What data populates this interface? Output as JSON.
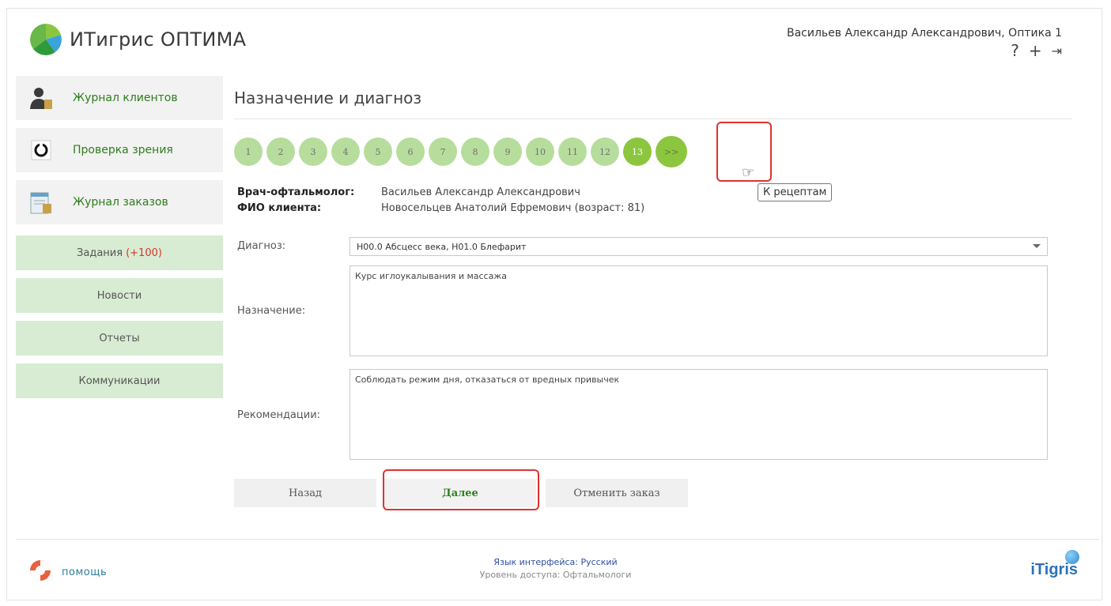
{
  "app": {
    "title": "ИТигрис ОПТИМА",
    "user": "Васильев Александр Александрович, Оптика 1",
    "header_icons": [
      "help-icon",
      "add-icon",
      "logout-icon"
    ]
  },
  "sidebar": {
    "main_items": [
      {
        "label": "Журнал клиентов",
        "icon": "clients-journal-icon"
      },
      {
        "label": "Проверка зрения",
        "icon": "vision-check-icon"
      },
      {
        "label": "Журнал заказов",
        "icon": "orders-journal-icon"
      }
    ],
    "tasks_label": "Задания",
    "tasks_count": "(+100)",
    "links": [
      "Новости",
      "Отчеты",
      "Коммуникации"
    ]
  },
  "page": {
    "title": "Назначение и диагноз",
    "steps": [
      "1",
      "2",
      "3",
      "4",
      "5",
      "6",
      "7",
      "8",
      "9",
      "10",
      "11",
      "12",
      "13"
    ],
    "active_step": "13",
    "next_step_label": ">>",
    "tooltip": "К рецептам"
  },
  "info": {
    "doctor_label": "Врач-офтальмолог:",
    "doctor_value": "Васильев Александр Александрович",
    "client_label": "ФИО клиента:",
    "client_value": "Новосельцев Анатолий Ефремович (возраст: 81)"
  },
  "form": {
    "diagnosis_label": "Диагноз:",
    "diagnosis_value": "H00.0 Абсцесс века, H01.0 Блефарит",
    "prescription_label": "Назначение:",
    "prescription_value": "Курс иглоукалывания и массажа",
    "recommendations_label": "Рекомендации:",
    "recommendations_value": "Соблюдать режим дня, отказаться от вредных привычек"
  },
  "buttons": {
    "back": "Назад",
    "next": "Далее",
    "cancel": "Отменить заказ"
  },
  "footer": {
    "help": "помощь",
    "language_label": "Язык интерфейса:",
    "language_value": "Русский",
    "access": "Уровень доступа: Офтальмологи",
    "brand": "iTigris"
  },
  "colors": {
    "accent_green": "#8cc63f",
    "step_green": "#b7dd9d",
    "sidebar_green": "#d8ecd3",
    "link_green": "#2e7d1c",
    "highlight_red": "#e03131"
  }
}
